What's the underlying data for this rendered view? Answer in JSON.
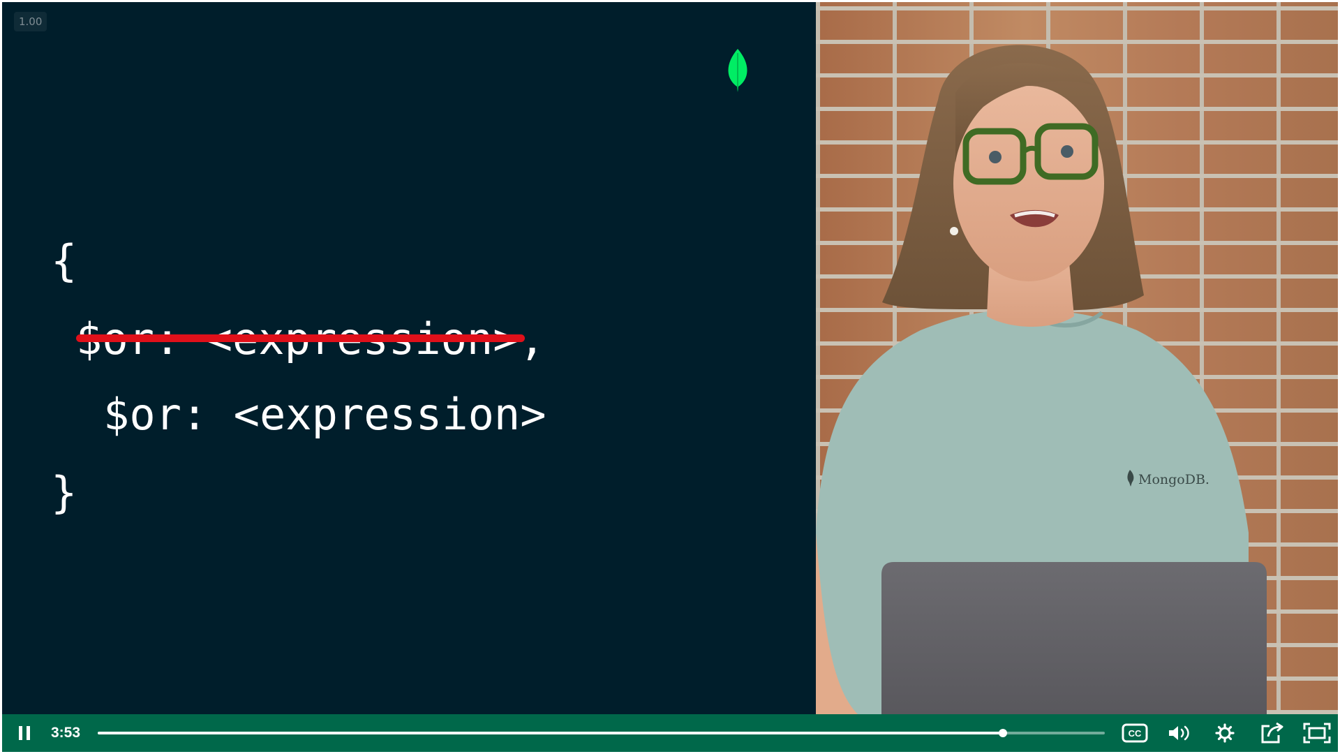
{
  "player": {
    "speed_badge": "1.00",
    "slide": {
      "brace_open": "{",
      "struck_line": "$or: <expression>",
      "struck_line_suffix": ",",
      "line": "$or: <expression>",
      "brace_close": "}"
    },
    "camera": {
      "shirt_logo": "MongoDB."
    },
    "controls": {
      "play_state": "playing",
      "time": "3:53",
      "progress": 0.8985,
      "icons": [
        "pause-icon",
        "closed-captions-icon",
        "volume-icon",
        "settings-icon",
        "popout-icon",
        "fullscreen-icon"
      ]
    }
  },
  "colors": {
    "slide_bg": "#001e2b",
    "leaf_green": "#00ed64",
    "strike_red": "#e0101a",
    "control_bar": "#00684a"
  }
}
